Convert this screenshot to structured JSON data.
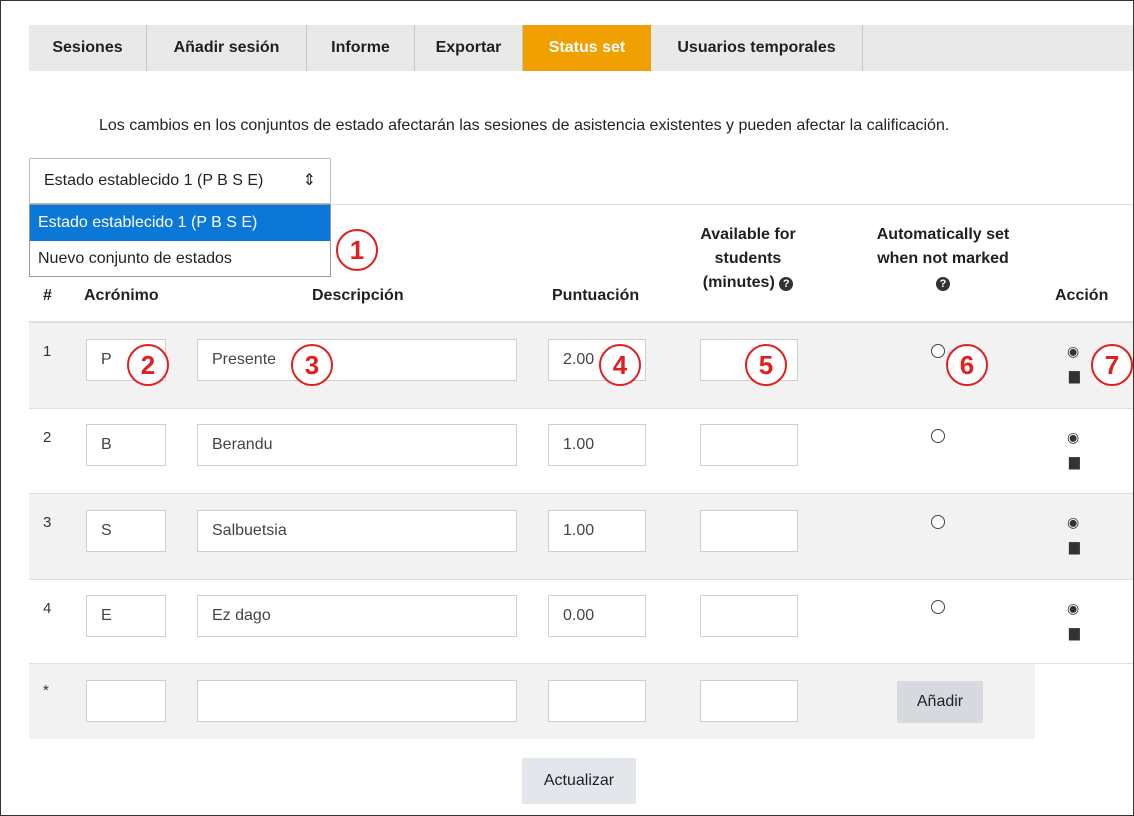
{
  "tabs": [
    {
      "label": "Sesiones"
    },
    {
      "label": "Añadir sesión"
    },
    {
      "label": "Informe"
    },
    {
      "label": "Exportar"
    },
    {
      "label": "Status set",
      "active": true
    },
    {
      "label": "Usuarios temporales"
    }
  ],
  "notice": "Los cambios en los conjuntos de estado afectarán las sesiones de asistencia existentes y pueden afectar la calificación.",
  "status_select": {
    "value": "Estado establecido 1 (P B S E)",
    "options": [
      "Estado establecido 1 (P B S E)",
      "Nuevo conjunto de estados"
    ]
  },
  "table": {
    "headers": {
      "num": "#",
      "acronym": "Acrónimo",
      "description": "Descripción",
      "score": "Puntuación",
      "available_1": "Available for",
      "available_2": "students",
      "available_3": "(minutes)",
      "auto_1": "Automatically set",
      "auto_2": "when not marked",
      "action": "Acción"
    },
    "rows": [
      {
        "num": "1",
        "acronym": "P",
        "description": "Presente",
        "score": "2.00",
        "minutes": ""
      },
      {
        "num": "2",
        "acronym": "B",
        "description": "Berandu",
        "score": "1.00",
        "minutes": ""
      },
      {
        "num": "3",
        "acronym": "S",
        "description": "Salbuetsia",
        "score": "1.00",
        "minutes": ""
      },
      {
        "num": "4",
        "acronym": "E",
        "description": "Ez dago",
        "score": "0.00",
        "minutes": ""
      }
    ],
    "new_row": {
      "num": "*",
      "add_label": "Añadir"
    }
  },
  "update_label": "Actualizar",
  "annotations": [
    "1",
    "2",
    "3",
    "4",
    "5",
    "6",
    "7"
  ],
  "colors": {
    "active_tab": "#f0a000",
    "selected_option": "#0b78d7",
    "annotation": "#e02020"
  },
  "icons": {
    "help": "help-icon",
    "view": "eye-icon",
    "delete": "trash-icon"
  }
}
